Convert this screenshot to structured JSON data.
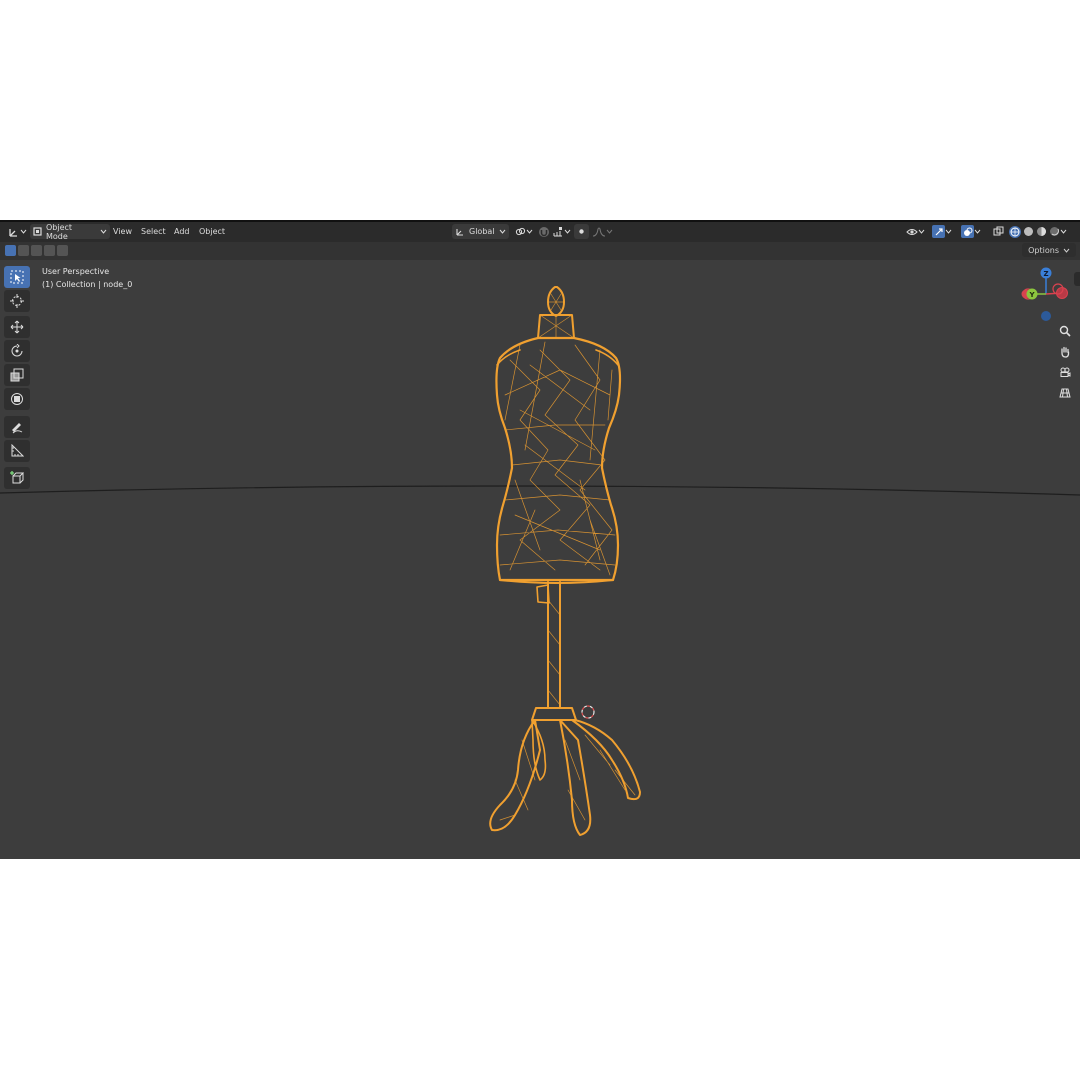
{
  "header": {
    "mode_label": "Object Mode",
    "menus": [
      "View",
      "Select",
      "Add",
      "Object"
    ],
    "orientation_label": "Global"
  },
  "options_label": "Options",
  "viewport": {
    "perspective_label": "User Perspective",
    "collection_label": "(1) Collection | node_0"
  },
  "gizmo": {
    "z_label": "Z",
    "y_label": "Y",
    "x_color": "#d9424f",
    "y_color": "#8cc63e",
    "z_color": "#3a7fd8"
  },
  "colors": {
    "viewport_bg": "#3d3d3d",
    "header_bg": "#2b2b2b",
    "accent": "#4772b3",
    "wireframe": "#f0a030"
  }
}
